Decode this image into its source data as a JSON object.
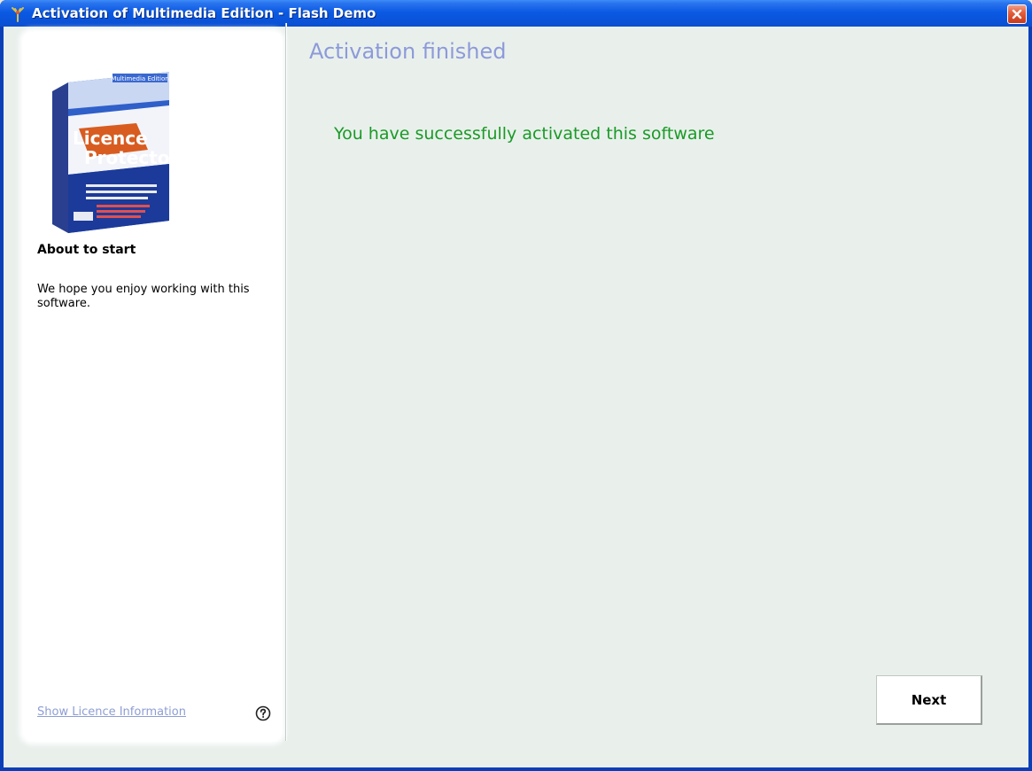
{
  "window": {
    "title": "Activation of Multimedia Edition - Flash Demo",
    "icon": "app-logo-icon",
    "close_icon": "close-icon"
  },
  "sidebar": {
    "product_image": "licence-protector-box",
    "product_text": {
      "edition": "Multimedia Edition",
      "name_line1": "Licence",
      "name_line2": "Protector"
    },
    "heading": "About to start",
    "text": "We hope you enjoy working with this software.",
    "licence_link": "Show Licence Information",
    "help_icon": "help-icon"
  },
  "main": {
    "heading": "Activation finished",
    "message": "You have successfully activated this software",
    "next_button": "Next"
  },
  "colors": {
    "title_bar": "#0b5ae3",
    "client_bg": "#e9f0ec",
    "heading": "#8d9ad9",
    "success": "#1a9a26",
    "link": "#8d9ed4"
  }
}
